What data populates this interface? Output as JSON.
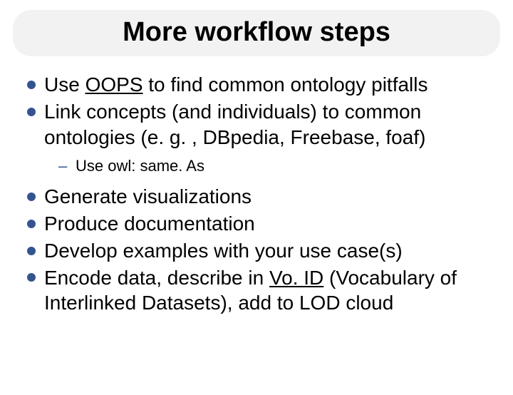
{
  "title": "More workflow steps",
  "bullets": {
    "b1_a": "Use ",
    "b1_link": "OOPS",
    "b1_b": " to find common ontology pitfalls",
    "b2": "Link concepts (and individuals) to common ontologies (e. g. , DBpedia, Freebase, foaf)",
    "b2_sub": "Use owl: same. As",
    "b3": "Generate visualizations",
    "b4": "Produce documentation",
    "b5": "Develop examples with your use case(s)",
    "b6_a": "Encode data, describe in ",
    "b6_link": "Vo. ID",
    "b6_b": " (Vocabulary of Interlinked Datasets),  add to LOD cloud"
  }
}
